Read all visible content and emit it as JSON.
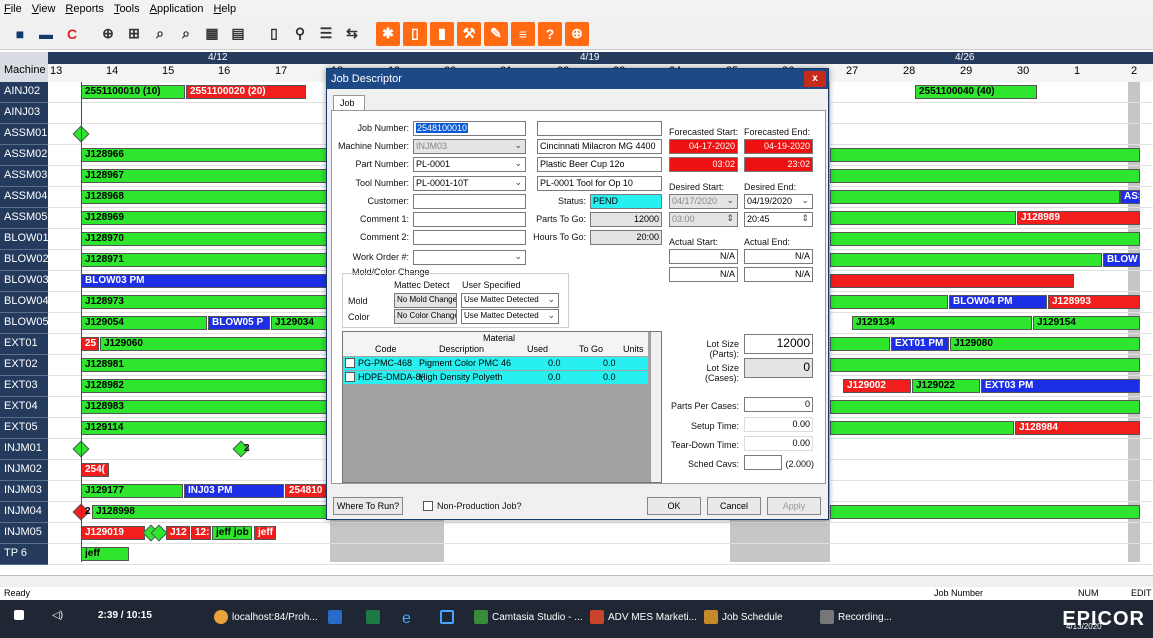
{
  "menu": [
    "File",
    "View",
    "Reports",
    "Tools",
    "Application",
    "Help"
  ],
  "toolbar_icons": [
    "save-icon",
    "print-icon",
    "refresh-icon",
    "add-job-icon",
    "add-jobs-icon",
    "find-job-icon",
    "find-jobs-icon",
    "calendar-icon",
    "calendar-grid-icon",
    "document-icon",
    "search-icon",
    "notepad-icon",
    "split-icon",
    "sun-icon",
    "page-icon",
    "chart-icon",
    "wrench-icon",
    "edit-icon",
    "list-icon",
    "help-icon",
    "globe-icon"
  ],
  "schedule": {
    "machine_label": "Machine",
    "dates": [
      {
        "label": "4/12"
      },
      {
        "label": "4/19"
      },
      {
        "label": "4/26"
      }
    ],
    "ticks": [
      "13",
      "14",
      "15",
      "16",
      "17",
      "18",
      "19",
      "20",
      "21",
      "22",
      "23",
      "24",
      "25",
      "26",
      "27",
      "28",
      "29",
      "30",
      "1",
      "2"
    ],
    "machines": [
      "AINJ02",
      "AINJ03",
      "ASSM01",
      "ASSM02",
      "ASSM03",
      "ASSM04",
      "ASSM05",
      "BLOW01",
      "BLOW02",
      "BLOW03",
      "BLOW04",
      "BLOW05",
      "EXT01",
      "EXT02",
      "EXT03",
      "EXT04",
      "EXT05",
      "INJM01",
      "INJM02",
      "INJM03",
      "INJM04",
      "INJM05",
      "TP 6"
    ],
    "bars": {
      "ainj02_a": "2551100010 (10)",
      "ainj02_b": "2551100020 (20)",
      "ainj02_c": "2551100040 (40)",
      "assm02": "J128966",
      "assm03": "J128967",
      "assm04": "J128968",
      "assm04_r": "ASS",
      "assm05": "J128969",
      "assm05_r": "J128989",
      "blow01": "J128970",
      "blow02": "J128971",
      "blow02_r": "BLOW",
      "blow03": "BLOW03 PM",
      "blow04": "J128973",
      "blow04_pm": "BLOW04 PM",
      "blow04_r": "J128993",
      "blow05": "J129054",
      "blow05_pm": "BLOW05 P",
      "blow05_b": "J129034",
      "blow05_c": "J129134",
      "blow05_d": "J129154",
      "ext01_a": "25",
      "ext01_b": "J129060",
      "ext01_pm": "EXT01 PM",
      "ext01_c": "J129080",
      "ext02": "J128981",
      "ext03": "J128982",
      "ext03_a": "J129002",
      "ext03_b": "J129022",
      "ext03_pm": "EXT03 PM",
      "ext04": "J128983",
      "ext05": "J129114",
      "ext05_r": "J128984",
      "injm01_d": "2",
      "injm02": "254(",
      "injm03": "J129177",
      "injm03_pm": "INJ03 PM",
      "injm03_r": "254810",
      "injm04_n": "2",
      "injm04": "J128998",
      "injm05_a": "J129019",
      "injm05_b": "J12",
      "injm05_c": "12:",
      "injm05_d": "jeff job",
      "injm05_e": "jeff",
      "tp6": "jeff"
    }
  },
  "dialog": {
    "title": "Job Descriptor",
    "close": "x",
    "tab": "Job",
    "job_number_label": "Job Number:",
    "job_number": "2548100010",
    "machine_number_label": "Machine Number:",
    "machine_number": "INJM03",
    "machine_desc": "Cincinnati Milacron MG 4400",
    "part_number_label": "Part Number:",
    "part_number": "PL-0001",
    "part_desc": "Plastic Beer Cup 12o",
    "tool_number_label": "Tool Number:",
    "tool_number": "PL-0001-10T",
    "tool_desc": "PL-0001 Tool for Op 10",
    "customer_label": "Customer:",
    "status_label": "Status:",
    "status": "PEND",
    "comment1_label": "Comment 1:",
    "parts_to_go_label": "Parts To Go:",
    "parts_to_go": "12000",
    "comment2_label": "Comment 2:",
    "hours_to_go_label": "Hours To Go:",
    "hours_to_go": "20:00",
    "work_order_label": "Work Order #:",
    "forecasted_start_label": "Forecasted Start:",
    "forecasted_end_label": "Forecasted End:",
    "forecasted_start_date": "04-17-2020",
    "forecasted_end_date": "04-19-2020",
    "forecasted_start_time": "03:02",
    "forecasted_end_time": "23:02",
    "desired_start_label": "Desired Start:",
    "desired_end_label": "Desired End:",
    "desired_start_date": "04/17/2020",
    "desired_end_date": "04/19/2020",
    "desired_start_time": "03:00",
    "desired_end_time": "20:45",
    "actual_start_label": "Actual Start:",
    "actual_end_label": "Actual End:",
    "na": "N/A",
    "mold_color_change_label": "Mold/Color Change",
    "mattec_detect_label": "Mattec Detect",
    "user_specified_label": "User Specified",
    "mold_label": "Mold",
    "color_label": "Color",
    "mold_detect": "No Mold Change",
    "color_detect": "No Color Change",
    "mold_user": "Use Mattec Detected",
    "color_user": "Use Mattec Detected",
    "material_label": "Material",
    "material_columns": [
      "Code",
      "Description",
      "Used",
      "To Go",
      "Units"
    ],
    "materials": [
      {
        "code": "PG-PMC-468",
        "description": "Pigment Color PMC 46",
        "used": "0.0",
        "togo": "0.0"
      },
      {
        "code": "HDPE-DMDA-8(",
        "description": "High Density Polyeth",
        "used": "0.0",
        "togo": "0.0"
      }
    ],
    "lot_size_parts_label": "Lot Size (Parts):",
    "lot_size_parts": "12000",
    "lot_size_cases_label": "Lot Size (Cases):",
    "lot_size_cases": "0",
    "parts_per_cases_label": "Parts Per Cases:",
    "parts_per_cases": "0",
    "setup_time_label": "Setup Time:",
    "setup_time": "0.00",
    "teardown_label": "Tear-Down Time:",
    "teardown": "0.00",
    "sched_cavs_label": "Sched Cavs:",
    "sched_cavs": "(2.000)",
    "where_to_run": "Where To Run?",
    "non_production": "Non-Production Job?",
    "ok": "OK",
    "cancel": "Cancel",
    "apply": "Apply"
  },
  "status": {
    "left": "Ready",
    "field": "Job Number",
    "num": "NUM",
    "edit": "EDIT"
  },
  "taskbar": {
    "clock": "2:39 / 10:15",
    "items": [
      "localhost:84/Proh...",
      "Camtasia Studio - ...",
      "ADV MES Marketi...",
      "Job Schedule",
      "Recording..."
    ],
    "date": "4/13/2020",
    "logo": "EPICOR"
  }
}
